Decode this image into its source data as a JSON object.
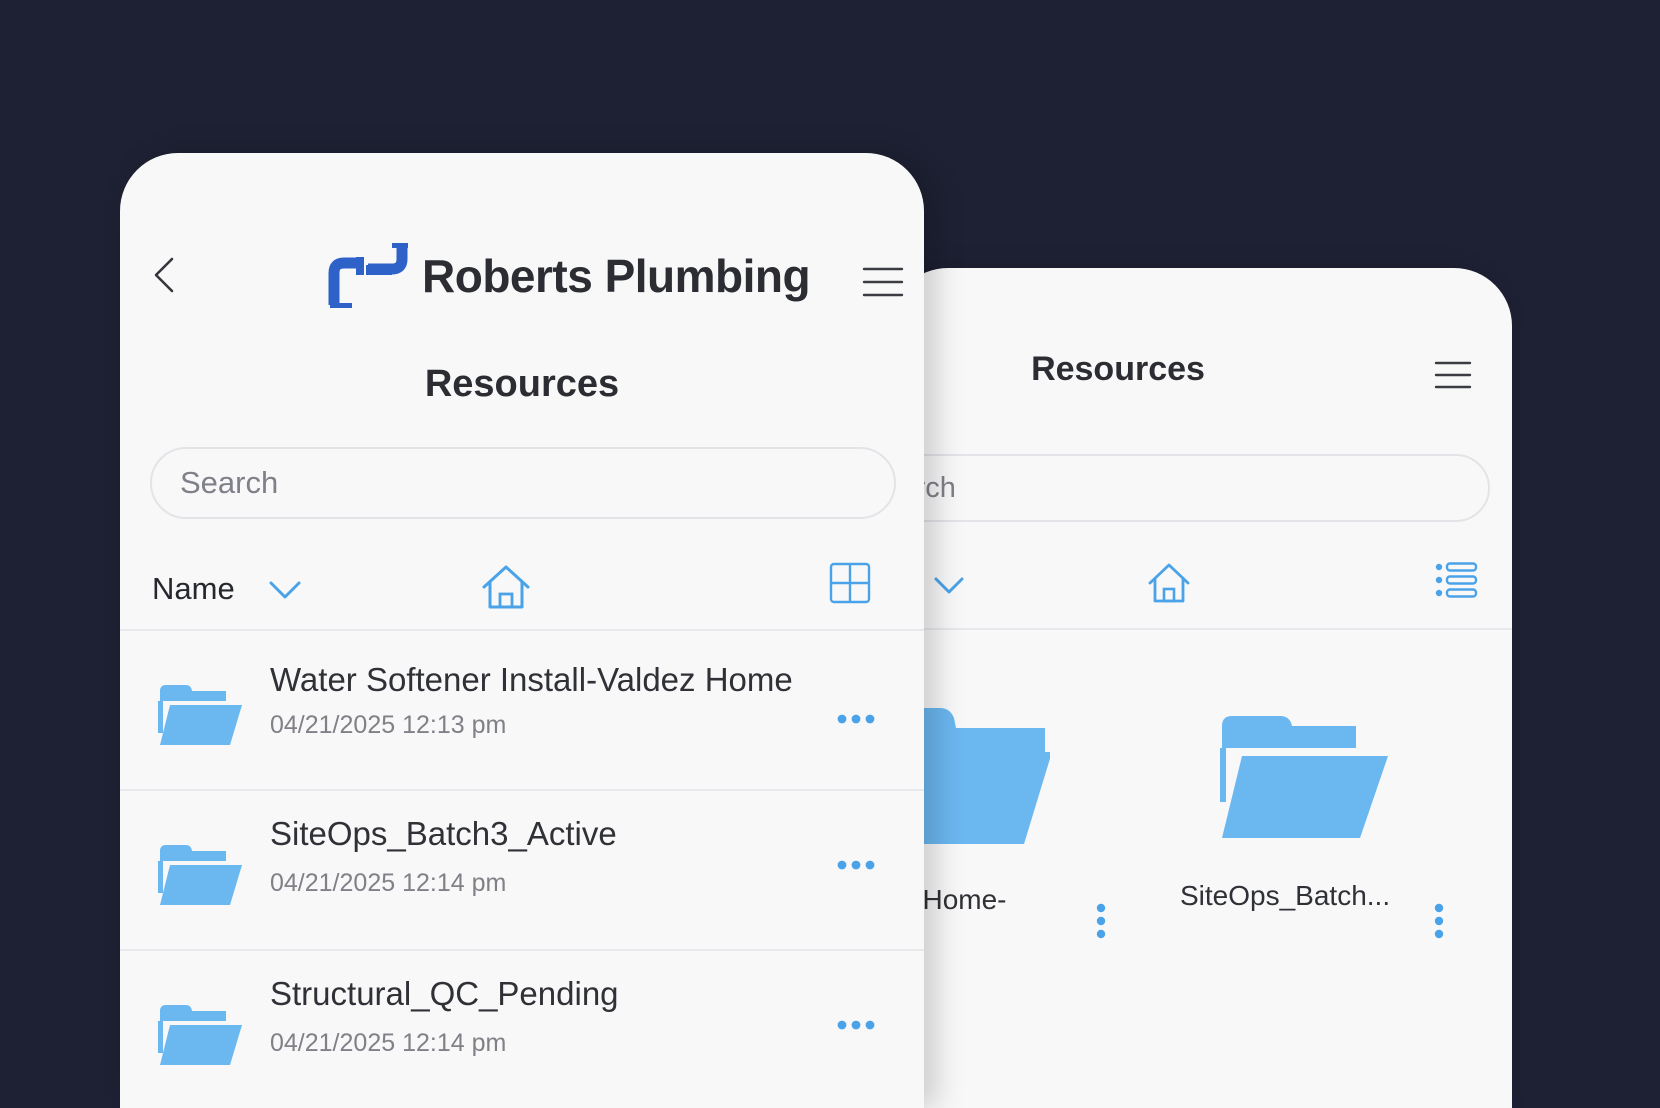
{
  "brand": {
    "name": "Roberts Plumbing",
    "logo_icon": "pipe-logo-icon"
  },
  "colors": {
    "background": "#1e2133",
    "card": "#f8f8f9",
    "accent": "#4aa3e8",
    "folder": "#6bb7f0",
    "logo_blue": "#2e62c9"
  },
  "front": {
    "title": "Resources",
    "search": {
      "placeholder": "Search"
    },
    "toolbar": {
      "sort_label": "Name"
    },
    "items": [
      {
        "name": "Water Softener Install-Valdez Home",
        "date": "04/21/2025 12:13 pm"
      },
      {
        "name": "SiteOps_Batch3_Active",
        "date": "04/21/2025 12:14 pm"
      },
      {
        "name": "Structural_QC_Pending",
        "date": "04/21/2025 12:14 pm"
      }
    ]
  },
  "back": {
    "title": "Resources",
    "search": {
      "placeholder": "Search"
    },
    "tiles": [
      {
        "label": "an-Home-"
      },
      {
        "label": "SiteOps_Batch..."
      }
    ]
  }
}
